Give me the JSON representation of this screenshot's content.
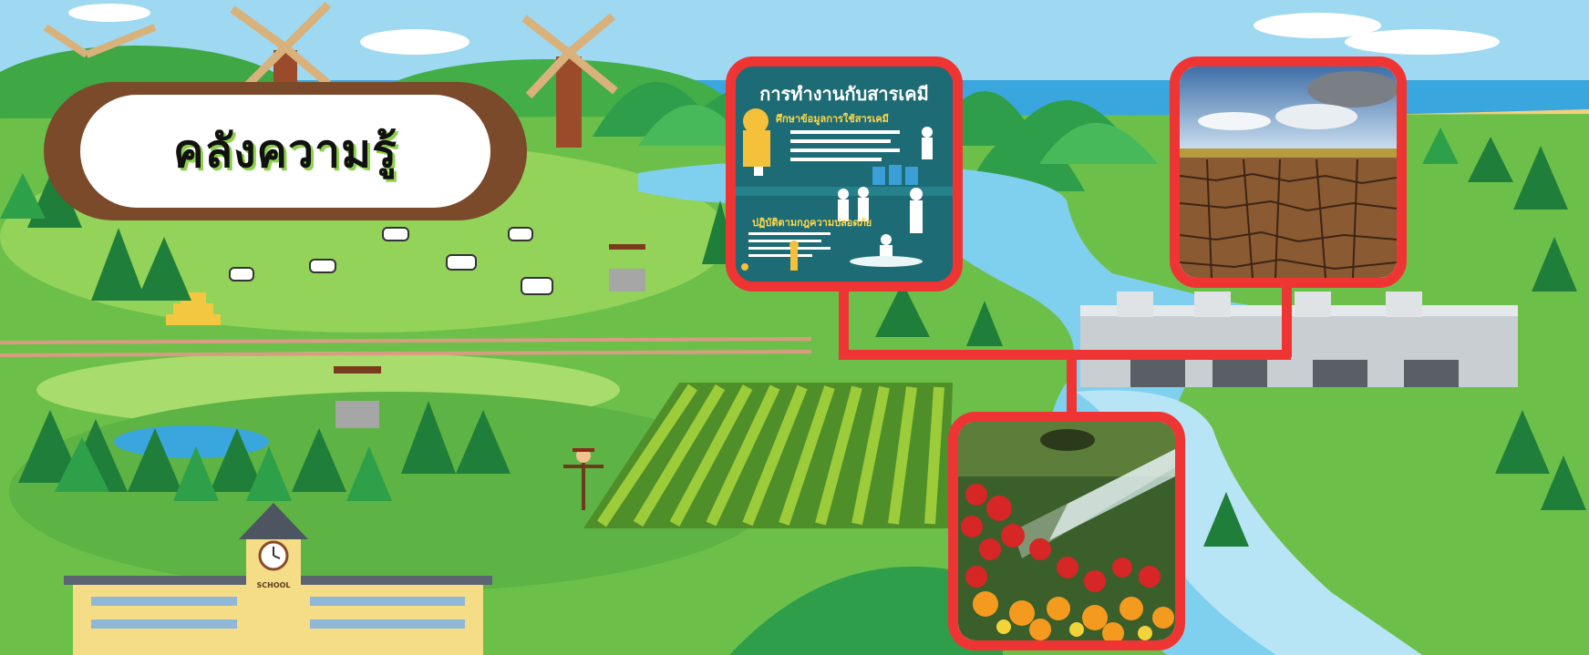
{
  "title": {
    "text": "คลังความรู้"
  },
  "building": {
    "sign": "SCHOOL"
  },
  "cards": [
    {
      "name": "chemical-safety-poster",
      "title": "การทำงานกับสารเคมี",
      "sub1": "ศึกษาข้อมูลการใช้สารเคมี",
      "sub2": "ปฏิบัติตามกฎความปลอดภัย"
    },
    {
      "name": "drought-cracked-soil-photo"
    },
    {
      "name": "garden-sprinkler-photo"
    }
  ],
  "colors": {
    "card_border": "#ef3434",
    "title_frame": "#7a4a2b",
    "grass": "#6cc04a",
    "river": "#7fd0ef"
  }
}
